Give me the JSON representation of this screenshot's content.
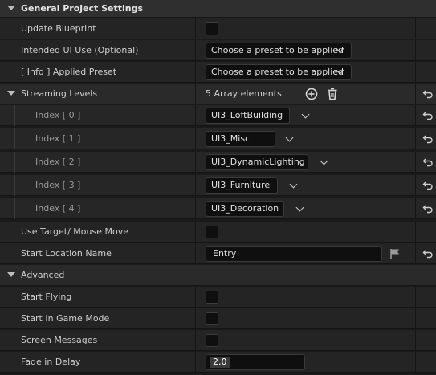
{
  "general": {
    "header": "General Project Settings",
    "update_blueprint": "Update Blueprint",
    "intended_ui_use": "Intended UI Use (Optional)",
    "intended_ui_value": "Choose a preset to be applied",
    "applied_preset": "[ Info ] Applied Preset",
    "applied_preset_value": "Choose a preset to be applied"
  },
  "streaming": {
    "label": "Streaming Levels",
    "count_text": "5 Array elements",
    "items": [
      {
        "index": "Index [ 0 ]",
        "value": "UI3_LoftBuilding"
      },
      {
        "index": "Index [ 1 ]",
        "value": "UI3_Misc"
      },
      {
        "index": "Index [ 2 ]",
        "value": "UI3_DynamicLighting"
      },
      {
        "index": "Index [ 3 ]",
        "value": "UI3_Furniture"
      },
      {
        "index": "Index [ 4 ]",
        "value": "UI3_Decoration"
      }
    ]
  },
  "use_target": "Use Target/ Mouse Move",
  "start_location": {
    "label": "Start Location Name",
    "value": "Entry"
  },
  "advanced": {
    "header": "Advanced",
    "start_flying": "Start Flying",
    "start_in_game": "Start In Game Mode",
    "screen_messages": "Screen Messages",
    "fade_in_delay": {
      "label": "Fade in Delay",
      "value": "2.0"
    }
  },
  "icons": {
    "collapse": "chevron-down-icon",
    "add": "add-circle-icon",
    "delete": "trash-icon",
    "reset": "reset-arrow-icon",
    "flag": "flag-icon"
  }
}
